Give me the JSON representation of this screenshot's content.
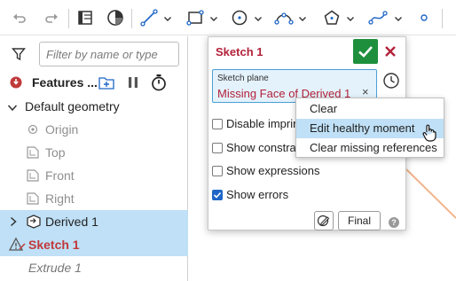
{
  "toolbar": {
    "icons": [
      "undo-icon",
      "redo-icon",
      "view-options-icon",
      "render-mode-icon",
      "line-icon",
      "rectangle-icon",
      "circle-icon",
      "arc-icon",
      "polygon-icon",
      "spline-icon",
      "point-icon"
    ]
  },
  "feature_panel": {
    "filter_placeholder": "Filter by name or type",
    "header": "Features ...",
    "items": [
      {
        "label": "Default geometry"
      },
      {
        "label": "Origin"
      },
      {
        "label": "Top"
      },
      {
        "label": "Front"
      },
      {
        "label": "Right"
      },
      {
        "label": "Derived 1"
      },
      {
        "label": "Sketch 1"
      },
      {
        "label": "Extrude 1"
      }
    ]
  },
  "sketch_dialog": {
    "title": "Sketch 1",
    "plane_label": "Sketch plane",
    "plane_value": "Missing Face of Derived 1",
    "plane_clear": "×",
    "options": [
      {
        "label": "Disable imprinting",
        "checked": false
      },
      {
        "label": "Show constraints",
        "checked": false
      },
      {
        "label": "Show expressions",
        "checked": false
      },
      {
        "label": "Show errors",
        "checked": true
      }
    ],
    "final_label": "Final",
    "help": "?"
  },
  "context_menu": {
    "items": [
      "Clear",
      "Edit healthy moment",
      "Clear missing references"
    ],
    "highlighted": 1
  },
  "colors": {
    "accent": "#1f66c7",
    "error": "#b3223a",
    "confirm": "#1e8f3d",
    "selection": "#bfe0f6",
    "canvas_line": "#f2b48c"
  }
}
